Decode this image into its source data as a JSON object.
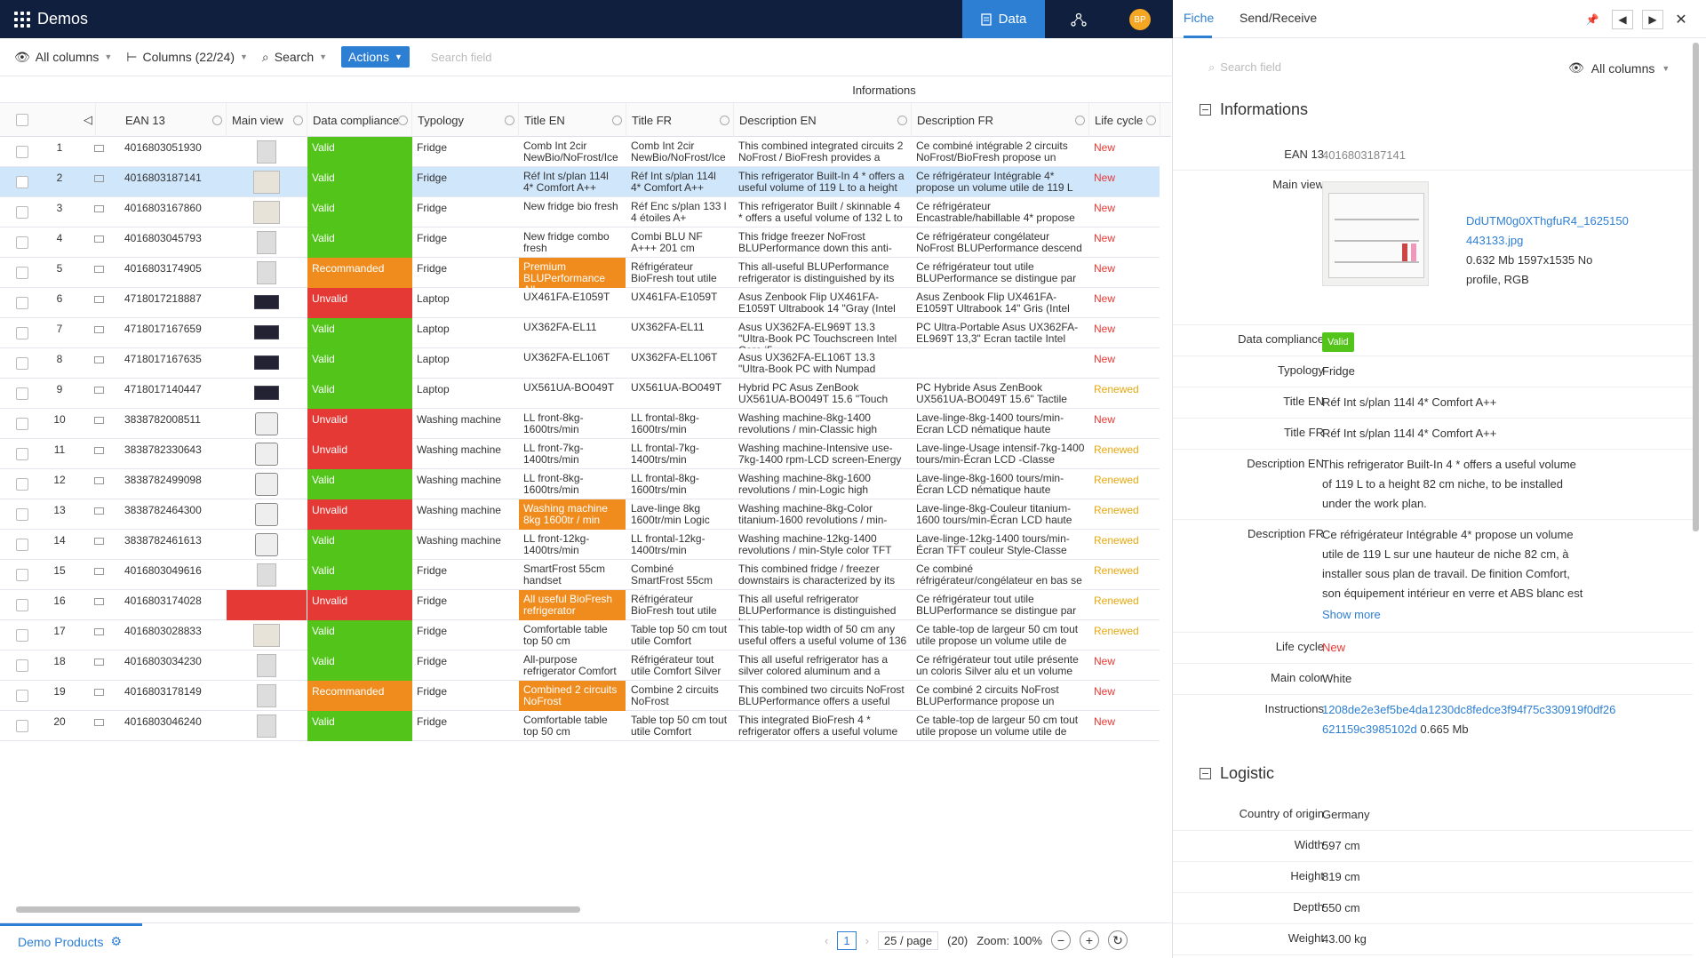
{
  "topbar": {
    "title": "Demos",
    "tab_data": "Data",
    "avatar_initials": "BP"
  },
  "toolbar": {
    "all_columns": "All columns",
    "columns": "Columns (22/24)",
    "search": "Search",
    "actions": "Actions",
    "search_placeholder": "Search field"
  },
  "grid": {
    "group_header": "Informations",
    "columns": {
      "ean": "EAN 13",
      "main_view": "Main view",
      "compliance": "Data compliance",
      "typology": "Typology",
      "title_en": "Title EN",
      "title_fr": "Title FR",
      "desc_en": "Description EN",
      "desc_fr": "Description FR",
      "life_cycle": "Life cycle"
    },
    "rows": [
      {
        "n": "1",
        "ean": "4016803051930",
        "img": "fridge",
        "comp": "Valid",
        "typ": "Fridge",
        "ten": "Comb Int 2cir NewBio/NoFrost/Ice",
        "tfr": "Comb Int 2cir NewBio/NoFrost/Ice",
        "den": "This combined integrated circuits 2 NoFrost / BioFresh provides a",
        "dfr": "Ce combiné intégrable 2 circuits NoFrost/BioFresh propose un",
        "lc": "New"
      },
      {
        "n": "2",
        "ean": "4016803187141",
        "img": "wide",
        "comp": "Valid",
        "typ": "Fridge",
        "ten": "Réf Int s/plan 114l 4* Comfort A++",
        "tfr": "Réf Int s/plan 114l 4* Comfort A++",
        "den": "This refrigerator Built-In 4 * offers a useful volume of 119 L to a height",
        "dfr": "Ce réfrigérateur Intégrable 4* propose un volume utile de 119 L",
        "lc": "New",
        "sel": true
      },
      {
        "n": "3",
        "ean": "4016803167860",
        "img": "wide",
        "comp": "Valid",
        "typ": "Fridge",
        "ten": "New fridge bio fresh",
        "tfr": "Réf Enc s/plan 133 l 4 étoiles A+",
        "den": "This refrigerator Built / skinnable 4 * offers a useful volume of 132 L to",
        "dfr": "Ce réfrigérateur Encastrable/habillable 4* propose",
        "lc": "New"
      },
      {
        "n": "4",
        "ean": "4016803045793",
        "img": "fridge",
        "comp": "Valid",
        "typ": "Fridge",
        "ten": "New fridge combo fresh",
        "tfr": "Combi BLU NF A+++ 201 cm",
        "den": "This fridge freezer NoFrost BLUPerformance down this anti-",
        "dfr": "Ce réfrigérateur congélateur NoFrost BLUPerformance descend",
        "lc": "New"
      },
      {
        "n": "5",
        "ean": "4016803174905",
        "img": "fridge",
        "comp": "Recommanded",
        "typ": "Fridge",
        "ten": "Premium BLUPerformance All-",
        "tfr": "Réfrigérateur BioFresh tout utile",
        "den": "This all-useful BLUPerformance refrigerator is distinguished by its",
        "dfr": "Ce réfrigérateur tout utile BLUPerformance se distingue par",
        "lc": "New",
        "tenOrange": true
      },
      {
        "n": "6",
        "ean": "4718017218887",
        "img": "laptop",
        "comp": "Unvalid",
        "typ": "Laptop",
        "ten": "UX461FA-E1059T",
        "tfr": "UX461FA-E1059T",
        "den": "Asus Zenbook Flip UX461FA-E1059T Ultrabook 14 \"Gray (Intel",
        "dfr": "Asus Zenbook Flip UX461FA-E1059T Ultrabook 14\" Gris (Intel",
        "lc": "New"
      },
      {
        "n": "7",
        "ean": "4718017167659",
        "img": "laptop",
        "comp": "Valid",
        "typ": "Laptop",
        "ten": "UX362FA-EL11",
        "tfr": "UX362FA-EL11",
        "den": "Asus UX362FA-EL969T 13.3 \"Ultra-Book PC Touchscreen Intel Core i5",
        "dfr": "PC Ultra-Portable Asus UX362FA-EL969T 13,3\" Ecran tactile Intel",
        "lc": "New"
      },
      {
        "n": "8",
        "ean": "4718017167635",
        "img": "laptop",
        "comp": "Valid",
        "typ": "Laptop",
        "ten": "UX362FA-EL106T",
        "tfr": "UX362FA-EL106T",
        "den": "Asus UX362FA-EL106T 13.3 \"Ultra-Book PC with Numpad",
        "dfr": "",
        "lc": "New"
      },
      {
        "n": "9",
        "ean": "4718017140447",
        "img": "laptop",
        "comp": "Valid",
        "typ": "Laptop",
        "ten": "UX561UA-BO049T",
        "tfr": "UX561UA-BO049T",
        "den": "Hybrid PC Asus ZenBook UX561UA-BO049T 15.6 \"Touch",
        "dfr": "PC Hybride Asus ZenBook UX561UA-BO049T 15.6\" Tactile",
        "lc": "Renewed"
      },
      {
        "n": "10",
        "ean": "3838782008511",
        "img": "washer",
        "comp": "Unvalid",
        "typ": "Washing machine",
        "ten": "LL front-8kg-1600trs/min",
        "tfr": "LL frontal-8kg-1600trs/min",
        "den": "Washing machine-8kg-1400 revolutions / min-Classic high",
        "dfr": "Lave-linge-8kg-1400 tours/min-Ecran LCD nématique haute",
        "lc": "New"
      },
      {
        "n": "11",
        "ean": "3838782330643",
        "img": "washer",
        "comp": "Unvalid",
        "typ": "Washing machine",
        "ten": "LL front-7kg-1400trs/min",
        "tfr": "LL frontal-7kg-1400trs/min",
        "den": "Washing machine-Intensive use-7kg-1400 rpm-LCD screen-Energy",
        "dfr": "Lave-linge-Usage intensif-7kg-1400 tours/min-Écran LCD -Classe",
        "lc": "Renewed"
      },
      {
        "n": "12",
        "ean": "3838782499098",
        "img": "washer",
        "comp": "Valid",
        "typ": "Washing machine",
        "ten": "LL front-8kg-1600trs/min",
        "tfr": "LL frontal-8kg-1600trs/min",
        "den": "Washing machine-8kg-1600 revolutions / min-Logic high",
        "dfr": "Lave-linge-8kg-1600 tours/min-Écran LCD nématique haute",
        "lc": "Renewed"
      },
      {
        "n": "13",
        "ean": "3838782464300",
        "img": "washer",
        "comp": "Unvalid",
        "typ": "Washing machine",
        "ten": "Washing machine 8kg 1600tr / min",
        "tfr": "Lave-linge 8kg 1600tr/min Logic",
        "den": "Washing machine-8kg-Color titanium-1600 revolutions / min-",
        "dfr": "Lave-linge-8kg-Couleur titanium-1600 tours/min-Écran LCD haute",
        "lc": "Renewed",
        "tenOrange": true
      },
      {
        "n": "14",
        "ean": "3838782461613",
        "img": "washer",
        "comp": "Valid",
        "typ": "Washing machine",
        "ten": "LL front-12kg-1400trs/min",
        "tfr": "LL frontal-12kg-1400trs/min",
        "den": "Washing machine-12kg-1400 revolutions / min-Style color TFT",
        "dfr": "Lave-linge-12kg-1400 tours/min-Écran TFT couleur Style-Classe",
        "lc": "Renewed"
      },
      {
        "n": "15",
        "ean": "4016803049616",
        "img": "fridge",
        "comp": "Valid",
        "typ": "Fridge",
        "ten": "SmartFrost 55cm handset",
        "tfr": "Combiné SmartFrost 55cm",
        "den": "This combined fridge / freezer downstairs is characterized by its",
        "dfr": "Ce combiné réfrigérateur/congélateur en bas se",
        "lc": "Renewed"
      },
      {
        "n": "16",
        "ean": "4016803174028",
        "img": "red",
        "comp": "Unvalid",
        "typ": "Fridge",
        "ten": "All useful BioFresh refrigerator",
        "tfr": "Réfrigérateur BioFresh tout utile",
        "den": "This all useful refrigerator BLUPerformance is distinguished by",
        "dfr": "Ce réfrigérateur tout utile BLUPerformance se distingue par",
        "lc": "Renewed",
        "tenOrange": true
      },
      {
        "n": "17",
        "ean": "4016803028833",
        "img": "wide",
        "comp": "Valid",
        "typ": "Fridge",
        "ten": "Comfortable table top 50 cm",
        "tfr": "Table top 50 cm tout utile Comfort",
        "den": "This table-top width of 50 cm any useful offers a useful volume of 136",
        "dfr": "Ce table-top de largeur 50 cm tout utile propose un volume utile de",
        "lc": "Renewed"
      },
      {
        "n": "18",
        "ean": "4016803034230",
        "img": "fridge",
        "comp": "Valid",
        "typ": "Fridge",
        "ten": "All-purpose refrigerator Comfort",
        "tfr": "Réfrigérateur tout utile Comfort Silver",
        "den": "This all useful refrigerator has a silver colored aluminum and a",
        "dfr": "Ce réfrigérateur tout utile présente un coloris Silver alu et un volume",
        "lc": "New"
      },
      {
        "n": "19",
        "ean": "4016803178149",
        "img": "fridge",
        "comp": "Recommanded",
        "typ": "Fridge",
        "ten": "Combined 2 circuits NoFrost",
        "tfr": "Combine 2 circuits NoFrost",
        "den": "This combined two circuits NoFrost BLUPerformance offers a useful",
        "dfr": "Ce combiné 2 circuits NoFrost BLUPerformance propose un",
        "lc": "New",
        "tenOrange": true
      },
      {
        "n": "20",
        "ean": "4016803046240",
        "img": "fridge",
        "comp": "Valid",
        "typ": "Fridge",
        "ten": "Comfortable table top 50 cm",
        "tfr": "Table top 50 cm tout utile Comfort",
        "den": "This integrated BioFresh 4 * refrigerator offers a useful volume",
        "dfr": "Ce table-top de largeur 50 cm tout utile propose un volume utile de",
        "lc": "New"
      }
    ]
  },
  "footer": {
    "project": "Demo Products",
    "page": "1",
    "page_size": "25 / page",
    "total": "(20)",
    "zoom": "Zoom: 100%"
  },
  "panel": {
    "tab_fiche": "Fiche",
    "tab_send": "Send/Receive",
    "search_placeholder": "Search field",
    "all_columns": "All columns",
    "section_info": "Informations",
    "section_logistic": "Logistic",
    "labels": {
      "ean": "EAN 13",
      "main_view": "Main view",
      "compliance": "Data compliance",
      "typology": "Typology",
      "title_en": "Title EN",
      "title_fr": "Title FR",
      "desc_en": "Description EN",
      "desc_fr": "Description FR",
      "life_cycle": "Life cycle",
      "main_color": "Main color",
      "instructions": "Instructions",
      "country": "Country of origin",
      "width": "Width",
      "height": "Height",
      "depth": "Depth",
      "weight": "Weight"
    },
    "values": {
      "ean": "4016803187141",
      "img_name_1": "DdUTM0g0XThgfuR4_1625150",
      "img_name_2": "443133.jpg",
      "img_meta_1": "0.632 Mb 1597x1535 No",
      "img_meta_2": "profile, RGB",
      "compliance": "Valid",
      "typology": "Fridge",
      "title_en": "Réf Int s/plan 114l 4* Comfort A++",
      "title_fr": "Réf Int s/plan 114l 4* Comfort A++",
      "desc_en": "This refrigerator Built-In 4 * offers a useful volume of 119 L to a height 82 cm niche, to be installed under the work plan.",
      "desc_fr": "Ce réfrigérateur Intégrable 4* propose un volume utile de 119 L sur une hauteur de niche 82 cm, à installer sous plan de travail. De finition Comfort, son équipement intérieur en verre et ABS blanc est relevé d'un éclairage",
      "show_more": "Show more",
      "life_cycle": "New",
      "main_color": "White",
      "instructions_link_1": "1208de2e3ef5be4da1230dc8fedce3f94f75c330919f0df26",
      "instructions_link_2": "621159c3985102d",
      "instructions_size": "0.665 Mb",
      "country": "Germany",
      "width": "597 cm",
      "height": "819 cm",
      "depth": "550 cm",
      "weight": "43.00 kg"
    }
  },
  "colors": {
    "topbar": "#0f1f3d",
    "accent": "#2d7fd3",
    "valid": "#52c41a",
    "unvalid": "#e53935",
    "recommanded": "#f08c1e",
    "new": "#e53935",
    "renewed": "#e8a80c"
  }
}
